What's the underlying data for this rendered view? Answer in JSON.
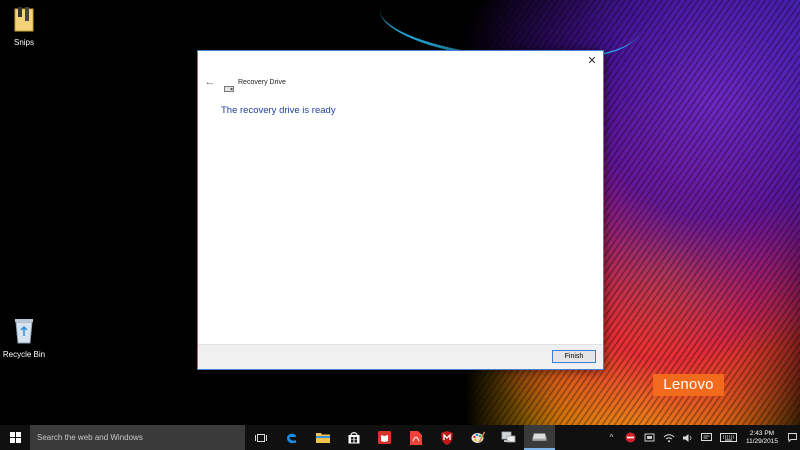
{
  "desktop": {
    "icons": [
      {
        "label": "Snips"
      },
      {
        "label": "Recycle Bin"
      }
    ],
    "brand": "Lenovo"
  },
  "dialog": {
    "close_glyph": "✕",
    "back_glyph": "←",
    "title": "Recovery Drive",
    "heading": "The recovery drive is ready",
    "finish_label": "Finish"
  },
  "taskbar": {
    "search_placeholder": "Search the web and Windows",
    "pinned": [
      "task-view",
      "edge",
      "file-explorer",
      "store",
      "app-red-book",
      "app-acrobat",
      "mcafee",
      "paint",
      "network-app",
      "recovery-drive"
    ],
    "tray": {
      "chevron": "^",
      "time": "2:43 PM",
      "date": "11/29/2015"
    }
  },
  "colors": {
    "accent": "#1e3f9a",
    "lenovo": "#f26b1d",
    "taskbar": "#101010",
    "search": "#3a3a3a"
  }
}
